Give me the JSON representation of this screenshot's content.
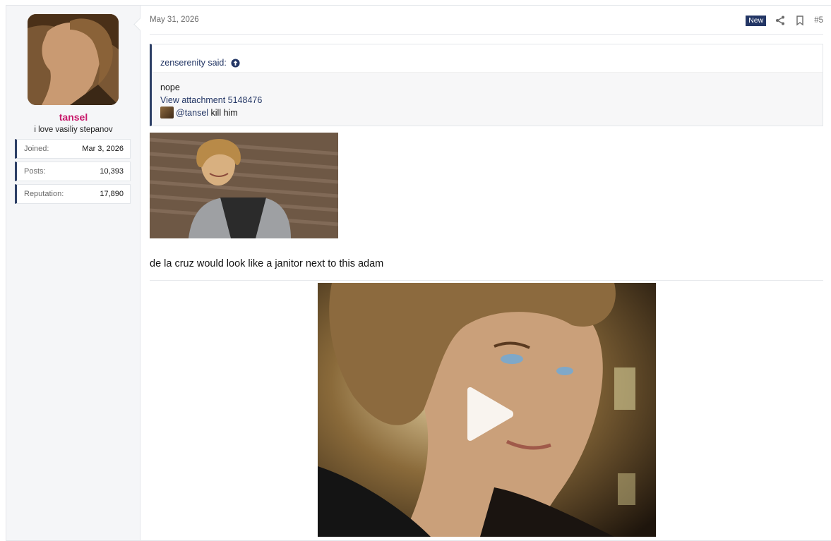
{
  "post": {
    "date": "May 31, 2026",
    "new_badge": "New",
    "post_number": "#5",
    "body_text": "de la cruz would look like a janitor next to this adam"
  },
  "user": {
    "name": "tansel",
    "title": "i love vasiliy stepanov",
    "stats": [
      {
        "label": "Joined:",
        "value": "Mar 3, 2026"
      },
      {
        "label": "Posts:",
        "value": "10,393"
      },
      {
        "label": "Reputation:",
        "value": "17,890"
      }
    ]
  },
  "quote": {
    "author": "zenserenity said:",
    "line1": "nope",
    "attachment_link": "View attachment 5148476",
    "mention": "@tansel",
    "mention_rest": " kill him"
  },
  "icons": {
    "share": "share-icon",
    "bookmark": "bookmark-icon",
    "quote_arrow": "arrow-up-circle-icon",
    "play": "play-icon"
  },
  "colors": {
    "accent": "#233665",
    "username": "#c8196b"
  }
}
